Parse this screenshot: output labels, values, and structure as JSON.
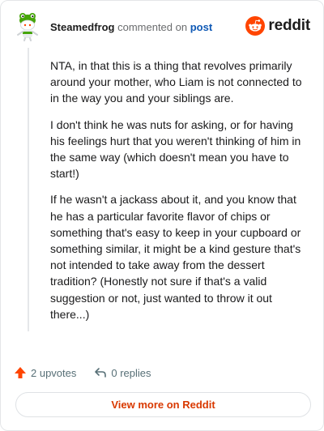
{
  "header": {
    "username": "Steamedfrog",
    "action_text": "commented on",
    "post_link": "post",
    "brand": "reddit"
  },
  "comment": {
    "paragraphs": [
      "NTA, in that this is a thing that revolves primarily around your mother, who Liam is not connected to in the way you and your siblings are.",
      "I don't think he was nuts for asking, or for having his feelings hurt that you weren't thinking of him in the same way (which doesn't mean you have to start!)",
      "If he wasn't a jackass about it, and you know that he has a particular favorite flavor of chips or something that's easy to keep in your cupboard or something similar, it might be a kind gesture that's not intended to take away from the dessert tradition? (Honestly not sure if that's a valid suggestion or not, just wanted to throw it out there...)"
    ]
  },
  "footer": {
    "upvotes": "2 upvotes",
    "replies": "0 replies"
  },
  "cta": {
    "label": "View more on Reddit"
  },
  "colors": {
    "brand_orange": "#ff4500",
    "upvote": "#ff4500",
    "cta_text": "#d93900",
    "link": "#0f59b5",
    "avatar_green": "#46a508"
  },
  "icons": [
    "snoo-avatar-icon",
    "reddit-logo-icon",
    "upvote-arrow-icon",
    "reply-arrow-icon"
  ]
}
